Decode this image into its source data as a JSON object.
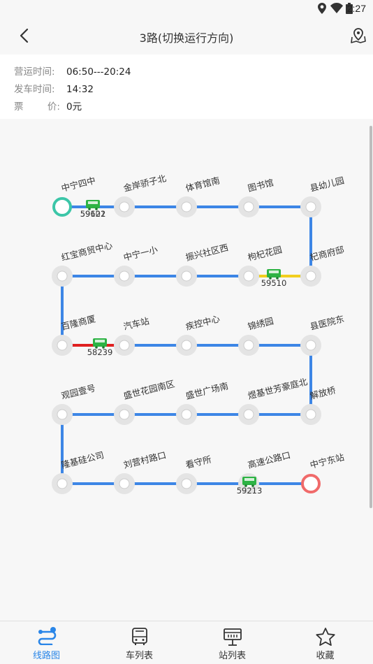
{
  "status_bar": {
    "time": "2:27"
  },
  "header": {
    "title": "3路(切换运行方向)"
  },
  "info": {
    "service_hours_label": "营运时间:",
    "service_hours": "06:50---20:24",
    "departure_label": "发车时间:",
    "departure_time": "14:32",
    "fare_label": "票        价:",
    "fare": "0元"
  },
  "route": {
    "rows": [
      [
        "中宁四中",
        "金岸骄子北",
        "体育馆南",
        "图书馆",
        "县幼儿园"
      ],
      [
        "红宝商贸中心",
        "中宁一小",
        "振兴社区西",
        "枸杞花园",
        "杞商府邸"
      ],
      [
        "百隆商厦",
        "汽车站",
        "疾控中心",
        "锦绣园",
        "县医院东"
      ],
      [
        "观园壹号",
        "盛世花园南区",
        "盛世广场南",
        "煜基世芳豪庭北",
        "解放桥"
      ],
      [
        "隆基硅公司",
        "刘营村路口",
        "看守所",
        "高速公路口",
        "中宁东站"
      ]
    ],
    "buses": [
      {
        "plate": "59622",
        "alt_plate": "59101"
      },
      {
        "plate": "59510"
      },
      {
        "plate": "58239"
      },
      {
        "plate": "59213"
      }
    ],
    "colors": {
      "line": "#3d86e6",
      "start": "#3cc6a8",
      "end": "#f06a6a",
      "slow": "#f2cf1f",
      "jam": "#e02020",
      "bus": "#2db344"
    }
  },
  "tabs": [
    {
      "label": "线路图",
      "icon": "route-icon",
      "active": true
    },
    {
      "label": "车列表",
      "icon": "bus-icon",
      "active": false
    },
    {
      "label": "站列表",
      "icon": "station-board-icon",
      "active": false
    },
    {
      "label": "收藏",
      "icon": "star-icon",
      "active": false
    }
  ]
}
